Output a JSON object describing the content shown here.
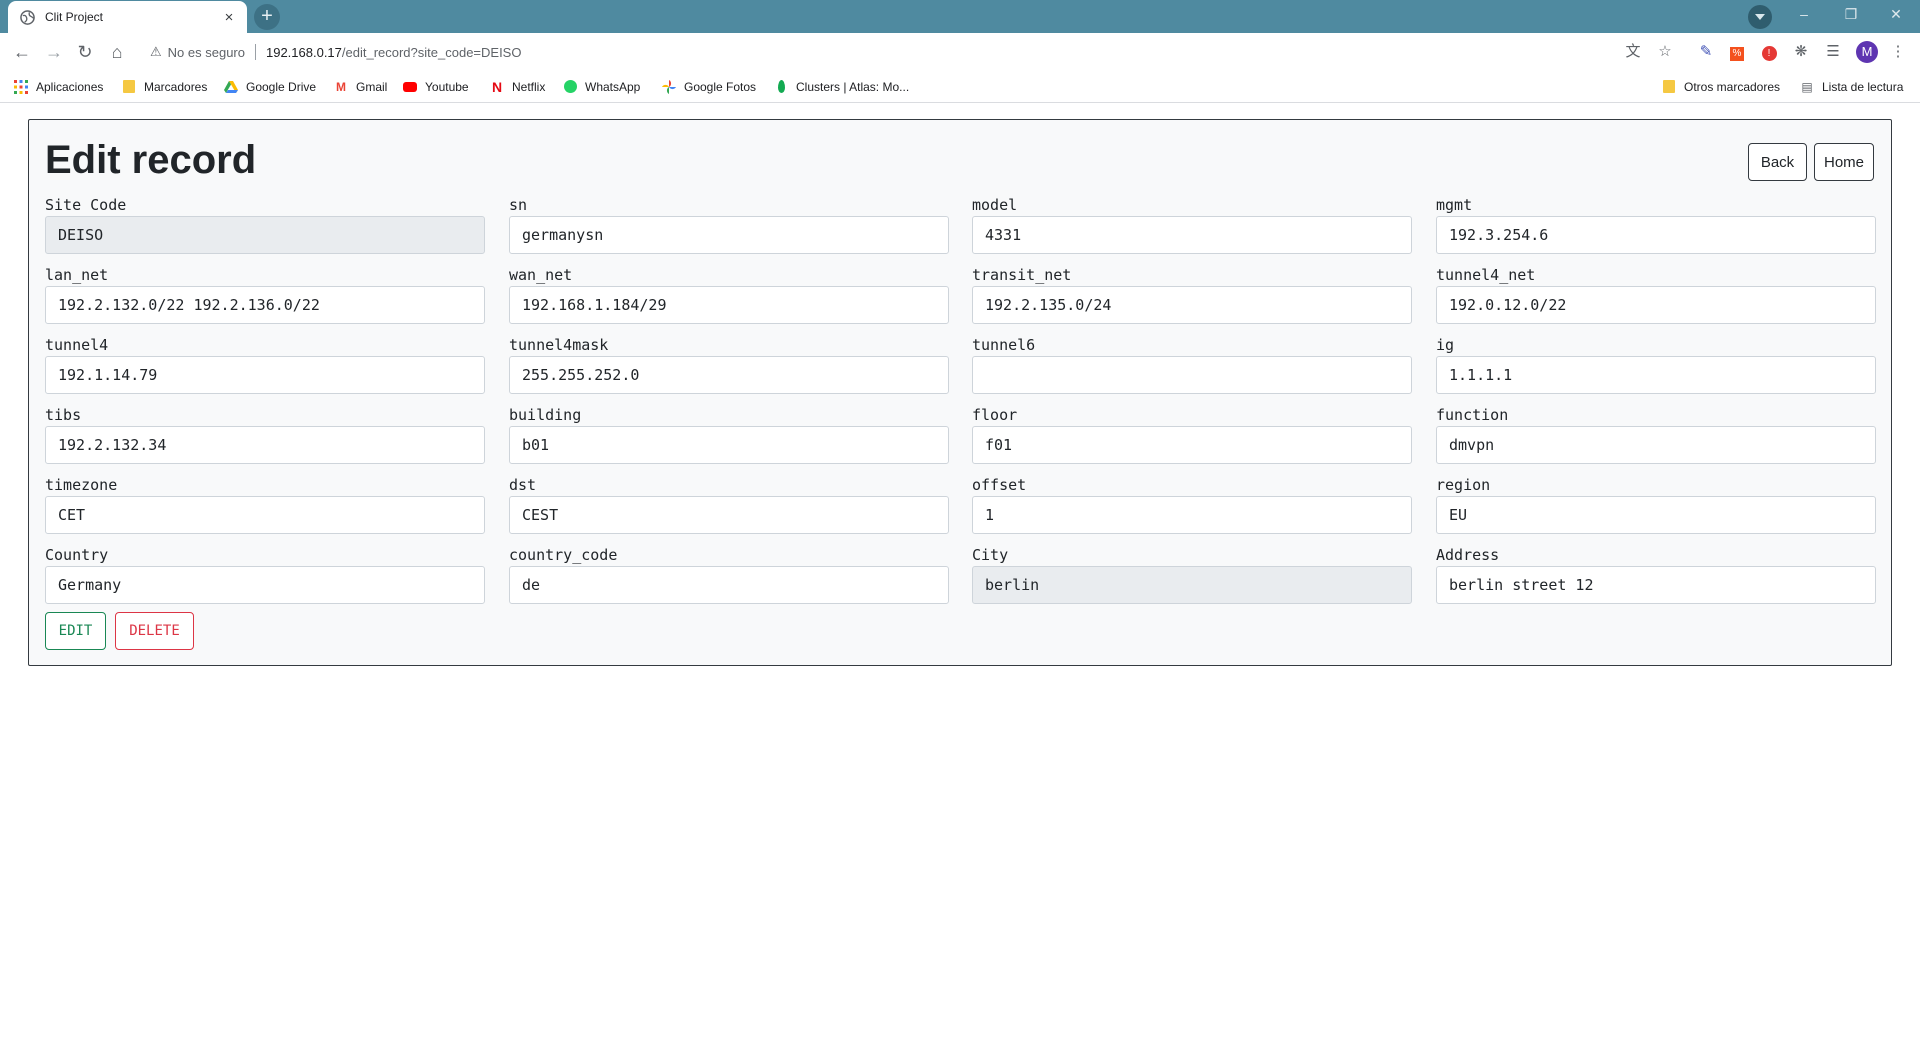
{
  "browser": {
    "tab_title": "Clit Project",
    "tab_close": "×",
    "new_tab": "+",
    "security_label": "No es seguro",
    "url_host": "192.168.0.17",
    "url_path": "/edit_record?site_code=DEISO",
    "profile_initial": "M",
    "bookmarks": [
      {
        "label": "Aplicaciones",
        "icon": "apps-grid-icon",
        "color": "#ea4335"
      },
      {
        "label": "Marcadores",
        "icon": "folder-icon",
        "color": "#f5c842"
      },
      {
        "label": "Google Drive",
        "icon": "google-drive-icon",
        "color": "#34a853"
      },
      {
        "label": "Gmail",
        "icon": "gmail-icon",
        "color": "#ea4335"
      },
      {
        "label": "Youtube",
        "icon": "youtube-icon",
        "color": "#ff0000"
      },
      {
        "label": "Netflix",
        "icon": "netflix-icon",
        "color": "#e50914"
      },
      {
        "label": "WhatsApp",
        "icon": "whatsapp-icon",
        "color": "#25d366"
      },
      {
        "label": "Google Fotos",
        "icon": "google-photos-icon",
        "color": "#fbbc04"
      },
      {
        "label": "Clusters | Atlas: Mo...",
        "icon": "mongodb-leaf-icon",
        "color": "#13aa52"
      }
    ],
    "other_bookmarks": "Otros marcadores",
    "reading_list": "Lista de lectura"
  },
  "page": {
    "title": "Edit record",
    "back_label": "Back",
    "home_label": "Home",
    "edit_label": "EDIT",
    "delete_label": "DELETE",
    "fields": [
      {
        "label": "Site Code",
        "value": "DEISO",
        "readonly": true
      },
      {
        "label": "sn",
        "value": "germanysn"
      },
      {
        "label": "model",
        "value": "4331"
      },
      {
        "label": "mgmt",
        "value": "192.3.254.6"
      },
      {
        "label": "lan_net",
        "value": "192.2.132.0/22 192.2.136.0/22"
      },
      {
        "label": "wan_net",
        "value": "192.168.1.184/29"
      },
      {
        "label": "transit_net",
        "value": "192.2.135.0/24"
      },
      {
        "label": "tunnel4_net",
        "value": "192.0.12.0/22"
      },
      {
        "label": "tunnel4",
        "value": "192.1.14.79"
      },
      {
        "label": "tunnel4mask",
        "value": "255.255.252.0"
      },
      {
        "label": "tunnel6",
        "value": ""
      },
      {
        "label": "ig",
        "value": "1.1.1.1"
      },
      {
        "label": "tibs",
        "value": "192.2.132.34"
      },
      {
        "label": "building",
        "value": "b01"
      },
      {
        "label": "floor",
        "value": "f01"
      },
      {
        "label": "function",
        "value": "dmvpn"
      },
      {
        "label": "timezone",
        "value": "CET"
      },
      {
        "label": "dst",
        "value": "CEST"
      },
      {
        "label": "offset",
        "value": "1"
      },
      {
        "label": "region",
        "value": "EU"
      },
      {
        "label": "Country",
        "value": "Germany"
      },
      {
        "label": "country_code",
        "value": "de"
      },
      {
        "label": "City",
        "value": "berlin",
        "readonly": true
      },
      {
        "label": "Address",
        "value": "berlin street 12"
      }
    ]
  }
}
